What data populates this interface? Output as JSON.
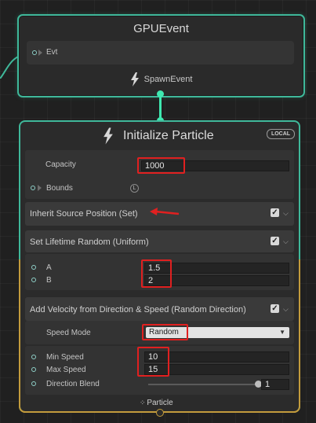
{
  "gpu_event_node": {
    "title": "GPUEvent",
    "port_label": "Evt",
    "output_label": "SpawnEvent"
  },
  "init_node": {
    "title": "Initialize Particle",
    "badge": "LOCAL",
    "capacity_label": "Capacity",
    "capacity_value": "1000",
    "bounds_label": "Bounds",
    "bounds_badge": "L",
    "footer_label": "Particle"
  },
  "blocks": {
    "inherit": {
      "label": "Inherit Source Position (Set)"
    },
    "lifetime": {
      "label": "Set Lifetime Random (Uniform)",
      "a_label": "A",
      "a_value": "1.5",
      "b_label": "B",
      "b_value": "2"
    },
    "velocity": {
      "label": "Add Velocity from Direction & Speed (Random Direction)",
      "speed_mode_label": "Speed Mode",
      "speed_mode_value": "Random",
      "min_speed_label": "Min Speed",
      "min_speed_value": "10",
      "max_speed_label": "Max Speed",
      "max_speed_value": "15",
      "direction_blend_label": "Direction Blend",
      "direction_blend_value": "1",
      "direction_blend_fraction": 1.0
    }
  },
  "colors": {
    "event_border": "#3fb89a",
    "link": "#3fe8b0",
    "annotation_red": "#e02020",
    "footer_border": "#c29b3c"
  }
}
